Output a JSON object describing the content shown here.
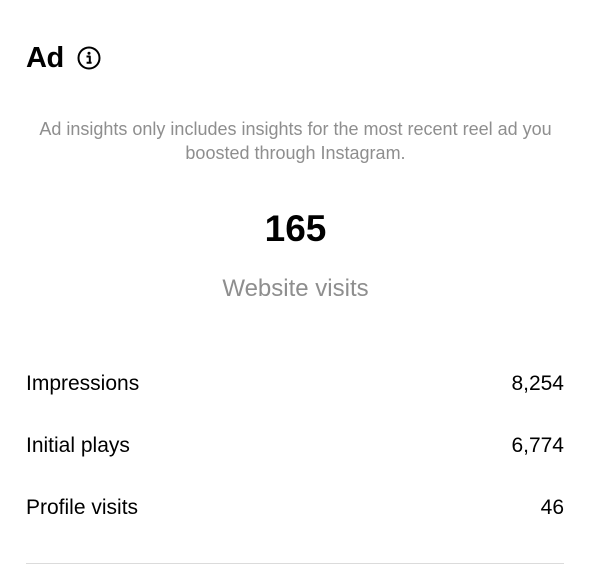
{
  "header": {
    "title": "Ad",
    "info_icon": "info-circle-icon"
  },
  "description": "Ad insights only includes insights for the most recent reel ad you boosted through Instagram.",
  "hero": {
    "value": "165",
    "label": "Website visits"
  },
  "stats": [
    {
      "label": "Impressions",
      "value": "8,254"
    },
    {
      "label": "Initial plays",
      "value": "6,774"
    },
    {
      "label": "Profile visits",
      "value": "46"
    }
  ],
  "colors": {
    "text_primary": "#000000",
    "text_secondary": "#8e8e8e",
    "divider": "#dbdbdb",
    "background": "#ffffff"
  }
}
